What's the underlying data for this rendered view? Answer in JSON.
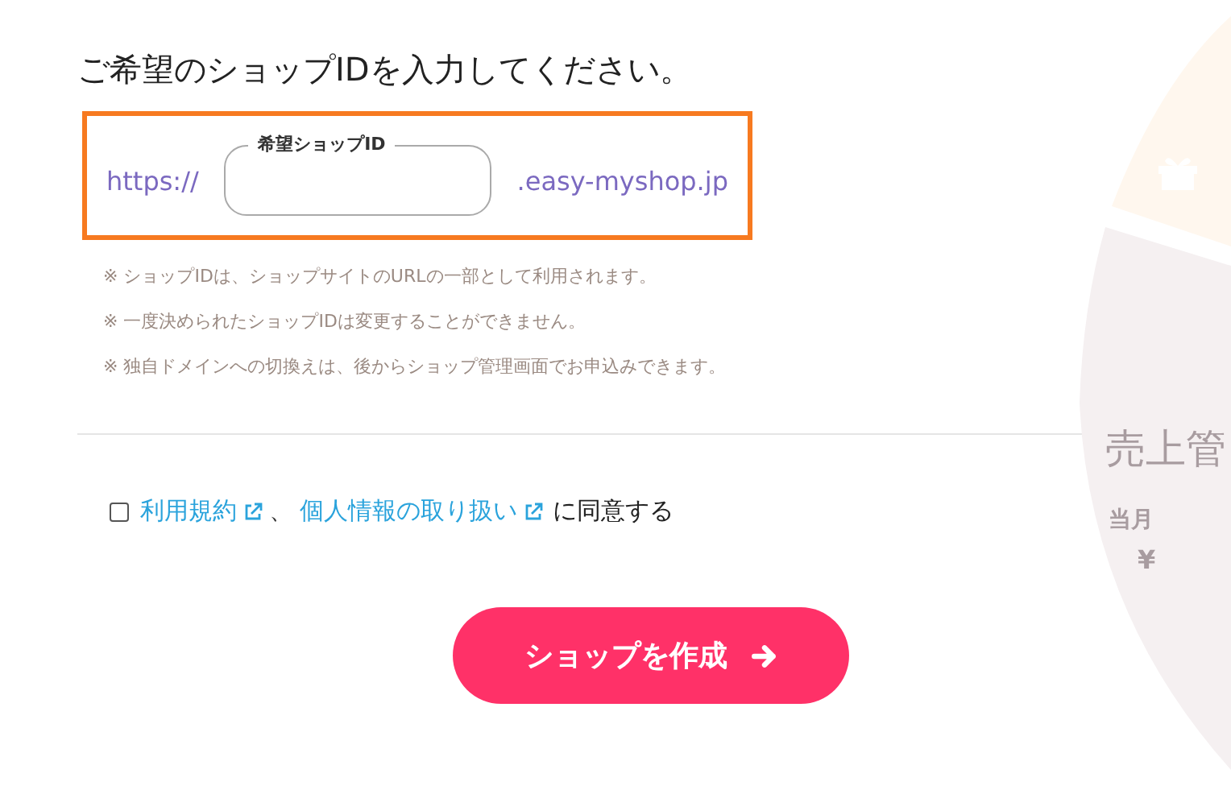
{
  "heading": "ご希望のショップIDを入力してください。",
  "shop_id": {
    "prefix": "https://",
    "label": "希望ショップID",
    "suffix": ".easy-myshop.jp",
    "highlighted": true
  },
  "notes": [
    "※ ショップIDは、ショップサイトのURLの一部として利用されます。",
    "※ 一度決められたショップIDは変更することができません。",
    "※ 独自ドメインへの切換えは、後からショップ管理画面でお申込みできます。"
  ],
  "agreement": {
    "checked": false,
    "links": [
      "利用規約",
      "個人情報の取り扱い"
    ],
    "separator": "、",
    "suffix": "に同意する"
  },
  "submit_button": {
    "label": "ショップを作成"
  },
  "background_graphic": {
    "title": "売上管",
    "subtitle": "当月",
    "currency": "¥"
  }
}
